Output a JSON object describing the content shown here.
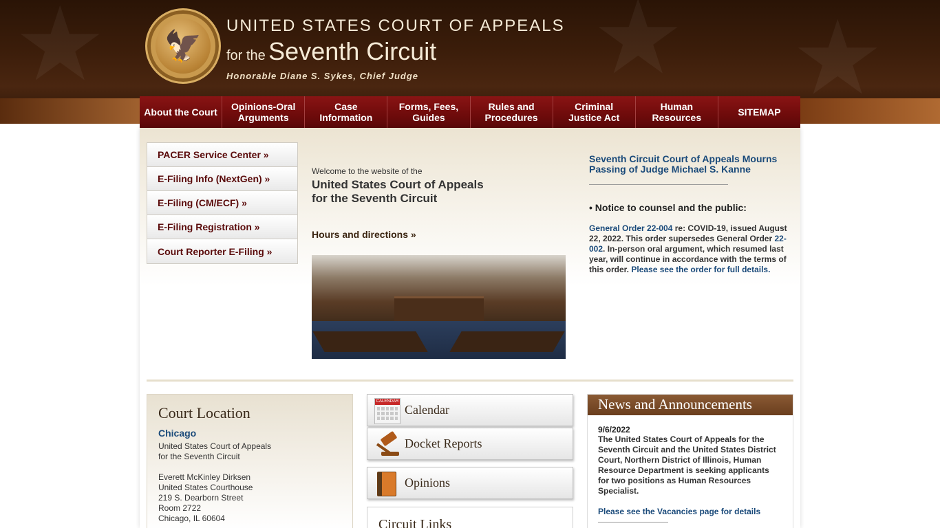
{
  "header": {
    "line1": "UNITED STATES COURT OF APPEALS",
    "line2_small": "for the",
    "line2_big": "Seventh Circuit",
    "chief_judge": "Honorable Diane S. Sykes, Chief Judge",
    "seal_icon": "court-seal-icon"
  },
  "nav": {
    "items": [
      {
        "label": "About the Court"
      },
      {
        "label": "Opinions-Oral Arguments"
      },
      {
        "label": "Case Information"
      },
      {
        "label": "Forms, Fees, Guides"
      },
      {
        "label": "Rules and Procedures"
      },
      {
        "label": "Criminal Justice Act"
      },
      {
        "label": "Human Resources"
      },
      {
        "label": "SITEMAP"
      }
    ]
  },
  "quicklinks": [
    {
      "label": "PACER Service Center »"
    },
    {
      "label": "E-Filing Info (NextGen) »"
    },
    {
      "label": "E-Filing (CM/ECF) »"
    },
    {
      "label": "E-Filing Registration »"
    },
    {
      "label": "Court Reporter E-Filing »"
    }
  ],
  "welcome": {
    "small": "Welcome to the website of the",
    "title_line1": "United States Court of Appeals",
    "title_line2": "for the Seventh Circuit",
    "hours_link": "Hours and directions »"
  },
  "notices": {
    "headline": "Seventh Circuit Court of Appeals Mourns Passing of Judge Michael S. Kanne",
    "notice_heading": "• Notice to counsel and the public:",
    "go_link": "General Order 22-004",
    "text1": " re: COVID-19, issued August 22, 2022. This order supersedes General Order ",
    "go_link2": "22-002",
    "text2": ".  In-person oral argument, which resumed last year, will continue in accordance with the terms of this order. ",
    "full_link": "Please see the order for full details."
  },
  "location": {
    "title": "Court Location",
    "city": "Chicago",
    "addr1": "United States Court of Appeals",
    "addr2": "for the Seventh Circuit",
    "addr3": "Everett McKinley Dirksen",
    "addr4": "United States Courthouse",
    "addr5": "219 S. Dearborn Street",
    "addr6": "Room 2722",
    "addr7": "Chicago, IL 60604"
  },
  "tiles": {
    "calendar": "Calendar",
    "calendar_icon_text": "CALENDAR",
    "docket": "Docket Reports",
    "opinions": "Opinions",
    "circuit_links": "Circuit Links"
  },
  "news": {
    "title": "News and Announcements",
    "date": "9/6/2022",
    "text": "The United States Court of Appeals for the Seventh Circuit and the United States District Court, Northern District of Illinois, Human Resource Department is seeking applicants for two positions as Human Resources Specialist.",
    "link": "Please see the Vacancies page for details"
  },
  "colors": {
    "nav_bg": "#6e0b0b",
    "link_blue": "#1a4a7a",
    "header_brown": "#3b1d0a"
  }
}
